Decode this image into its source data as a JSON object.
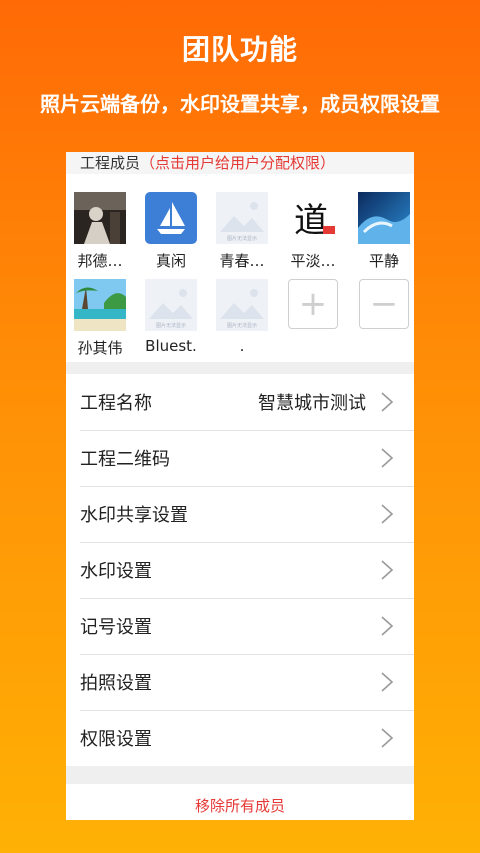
{
  "hero": {
    "title": "团队功能",
    "subtitle": "照片云端备份，水印设置共享，成员权限设置"
  },
  "members": {
    "header": "工程成员",
    "hint": "（点击用户给用户分配权限）",
    "list": [
      {
        "name": "邦德…",
        "avatar": "photo-dark"
      },
      {
        "name": "真闲",
        "avatar": "boat-icon"
      },
      {
        "name": "青春…",
        "avatar": "placeholder"
      },
      {
        "name": "平淡…",
        "avatar": "calligraphy"
      },
      {
        "name": "平静",
        "avatar": "wave-photo"
      },
      {
        "name": "孙其伟",
        "avatar": "beach-photo"
      },
      {
        "name": "Bluest.",
        "avatar": "placeholder"
      },
      {
        "name": ".",
        "avatar": "placeholder"
      }
    ],
    "add_label": "+",
    "remove_label": "−",
    "placeholder_caption": "图片无法显示"
  },
  "settings": [
    {
      "label": "工程名称",
      "value": "智慧城市测试"
    },
    {
      "label": "工程二维码",
      "value": ""
    },
    {
      "label": "水印共享设置",
      "value": ""
    },
    {
      "label": "水印设置",
      "value": ""
    },
    {
      "label": "记号设置",
      "value": ""
    },
    {
      "label": "拍照设置",
      "value": ""
    },
    {
      "label": "权限设置",
      "value": ""
    }
  ],
  "remove_all": "移除所有成员",
  "colors": {
    "accent": "#ff7a06",
    "danger": "#e53935",
    "boat_bg": "#3d7fd6"
  }
}
